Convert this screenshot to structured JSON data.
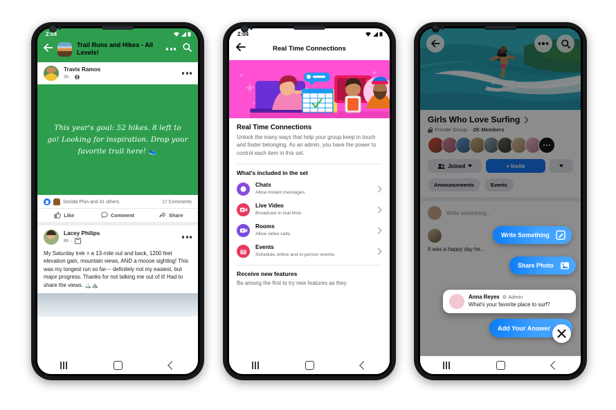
{
  "phone1": {
    "status": {
      "time": "2:04"
    },
    "header": {
      "title": "Trail Runs and Hikes - All Levels!",
      "back_icon": "back-arrow-icon",
      "more_icon": "more-options-icon",
      "search_icon": "search-icon"
    },
    "post1": {
      "author": "Travis Ramos",
      "time": "3h",
      "privacy_icon": "globe-icon",
      "text": "This year's goal: 52 hikes. 8 left to go! Looking for inspiration. Drop your favorite trail here! 👟",
      "background": "#2e9e4e",
      "reactions": "Sonida Phin and 41 others",
      "comments": "17 Comments",
      "actions": [
        "Like",
        "Comment",
        "Share"
      ]
    },
    "post2": {
      "author": "Lacey Philips",
      "time": "8h",
      "privacy_icon": "calendar-icon",
      "text": "My Saturday trek = a 13-mile out and back, 1200 feet elevation gain, mountain views, AND a moose sighting! This was my longest run so far--- definitely not my easiest, but major progress. Thanks for not talking me out of it! Had to share the views. 🏔️⛰️"
    }
  },
  "phone2": {
    "status": {
      "time": "2:04"
    },
    "header": {
      "title": "Real Time Connections",
      "back_icon": "back-arrow-icon"
    },
    "section": {
      "title": "Real Time Connections",
      "description": "Unlock the many ways that help your group keep in touch and foster belonging. As an admin, you have the power to control each item in this set.",
      "included_heading": "What's included in the set"
    },
    "features": [
      {
        "name": "Chats",
        "desc": "Allow instant messages.",
        "color": "#8a4ae0",
        "icon": "chat-bubble-icon"
      },
      {
        "name": "Live Video",
        "desc": "Broadcast in real time.",
        "color": "#e8395c",
        "icon": "live-video-icon"
      },
      {
        "name": "Rooms",
        "desc": "Allow video calls.",
        "color": "#7a4be0",
        "icon": "video-room-icon"
      },
      {
        "name": "Events",
        "desc": "Schedule online and in-person events.",
        "color": "#e8395c",
        "icon": "calendar-events-icon"
      }
    ],
    "footer": {
      "title": "Receive new features",
      "desc": "Be among the first to try new features as they"
    }
  },
  "phone3": {
    "header": {
      "back_icon": "back-arrow-icon",
      "more_icon": "more-options-icon",
      "search_icon": "search-icon"
    },
    "group": {
      "name": "Girls Who Love Surfing",
      "chevron_icon": "chevron-right-icon",
      "privacy": "Private Group",
      "members": "2K Members",
      "lock_icon": "lock-icon"
    },
    "buttons": {
      "joined": "Joined",
      "invite": "+ Invite",
      "more_icon": "chevron-down-icon"
    },
    "tabs": [
      "Announcements",
      "Events"
    ],
    "composer": {
      "placeholder": "Write something..."
    },
    "post": {
      "text": "It was a happy day he..."
    },
    "tooltips": [
      {
        "label": "Write Something",
        "icon": "compose-icon"
      },
      {
        "label": "Share Photo",
        "icon": "photo-icon"
      },
      {
        "label": "Add Your Answer",
        "icon": "add-answer-icon"
      }
    ],
    "card": {
      "author": "Anna Reyes",
      "badge": "Admin",
      "badge_icon": "admin-gear-icon",
      "question": "What's your favorite place to surf?"
    },
    "close_icon": "close-icon"
  },
  "navbar": {
    "recents_icon": "recents-icon",
    "home_icon": "home-icon",
    "back_icon": "back-icon"
  },
  "colors": {
    "green": "#2e9e4e",
    "blue": "#1877f2",
    "pink": "#ff4fd2",
    "grey": "#e4e6eb"
  }
}
